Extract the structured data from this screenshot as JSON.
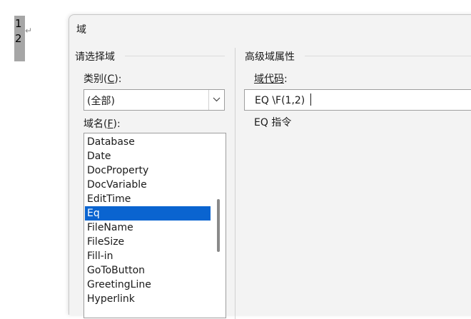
{
  "document": {
    "numerator": "1",
    "denominator": "2",
    "paragraph_mark": "↵"
  },
  "dialog": {
    "title": "域",
    "left_group": {
      "title": "请选择域",
      "category_label_prefix": "类别(",
      "category_label_key": "C",
      "category_label_suffix": "):",
      "category_value": "(全部)",
      "field_name_label_prefix": "域名(",
      "field_name_label_key": "F",
      "field_name_label_suffix": "):",
      "field_names": [
        "Database",
        "Date",
        "DocProperty",
        "DocVariable",
        "EditTime",
        "Eq",
        "FileName",
        "FileSize",
        "Fill-in",
        "GoToButton",
        "GreetingLine",
        "Hyperlink"
      ],
      "selected_field": "Eq"
    },
    "right_group": {
      "title": "高级域属性",
      "code_label_text": "域代码",
      "code_label_colon": ":",
      "code_value": "EQ \\F(1,2) ",
      "description": "EQ 指令"
    },
    "colors": {
      "selection": "#0a64d0",
      "dialog_background": "#f3f3f3"
    }
  }
}
